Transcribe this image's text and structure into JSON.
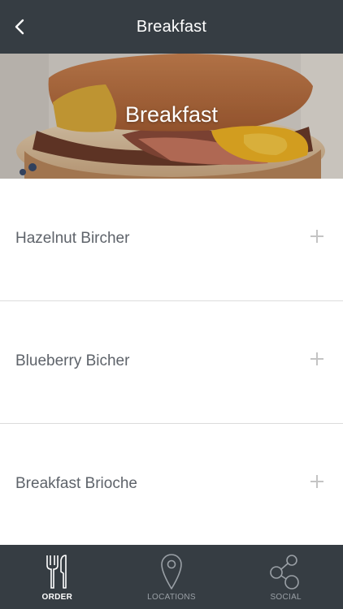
{
  "header": {
    "title": "Breakfast",
    "back_icon": "chevron-left-icon"
  },
  "hero": {
    "title": "Breakfast"
  },
  "menu": {
    "items": [
      {
        "label": "Hazelnut Bircher"
      },
      {
        "label": "Blueberry Bicher"
      },
      {
        "label": "Breakfast Brioche"
      }
    ],
    "add_icon": "plus-icon"
  },
  "tabs": [
    {
      "label": "ORDER",
      "icon": "fork-knife-icon",
      "active": true
    },
    {
      "label": "LOCATIONS",
      "icon": "location-pin-icon",
      "active": false
    },
    {
      "label": "SOCIAL",
      "icon": "share-icon",
      "active": false
    }
  ],
  "colors": {
    "bar_background": "#363d43",
    "item_text": "#5e636a",
    "plus": "#c4c4c4",
    "tab_inactive": "#9aa0a6"
  }
}
